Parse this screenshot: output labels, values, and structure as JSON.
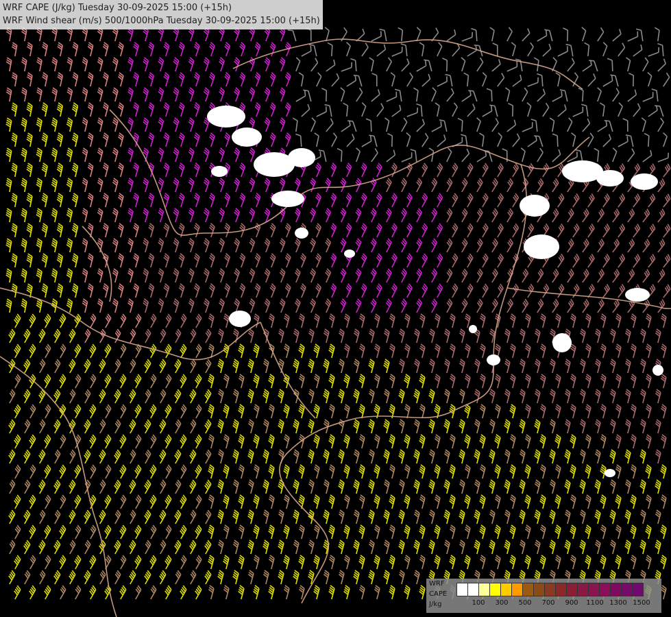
{
  "title": {
    "line1": "WRF CAPE (J/kg) Tuesday 30-09-2025 15:00 (+15h)",
    "line2": "WRF Wind shear (m/s) 500/1000hPa Tuesday 30-09-2025 15:00 (+15h)"
  },
  "legend": {
    "model_label": "WRF",
    "field_label": "CAPE",
    "unit_label": "J/kg",
    "colors": [
      "#ffffff",
      "#ffffff",
      "#ffff99",
      "#ffff00",
      "#ffcc00",
      "#ff9900",
      "#9c5a10",
      "#8c4a18",
      "#8a3a20",
      "#8a2a28",
      "#8a1e36",
      "#8a1a44",
      "#8a1450",
      "#8a0e5a",
      "#800a62",
      "#780a6a",
      "#700a70"
    ],
    "tick_labels": [
      "100",
      "300",
      "500",
      "700",
      "900",
      "1100",
      "1300",
      "1500"
    ]
  },
  "map": {
    "background": "#000000",
    "border_color": "#d9a88c",
    "barb_colors": {
      "cold": "#8a8a8a",
      "mid": "#a86a6a",
      "warm": "#d98080",
      "magenta": "#d020d0",
      "yellow": "#e0e000",
      "tan": "#b08860"
    },
    "cloud_color": "#ffffff"
  }
}
